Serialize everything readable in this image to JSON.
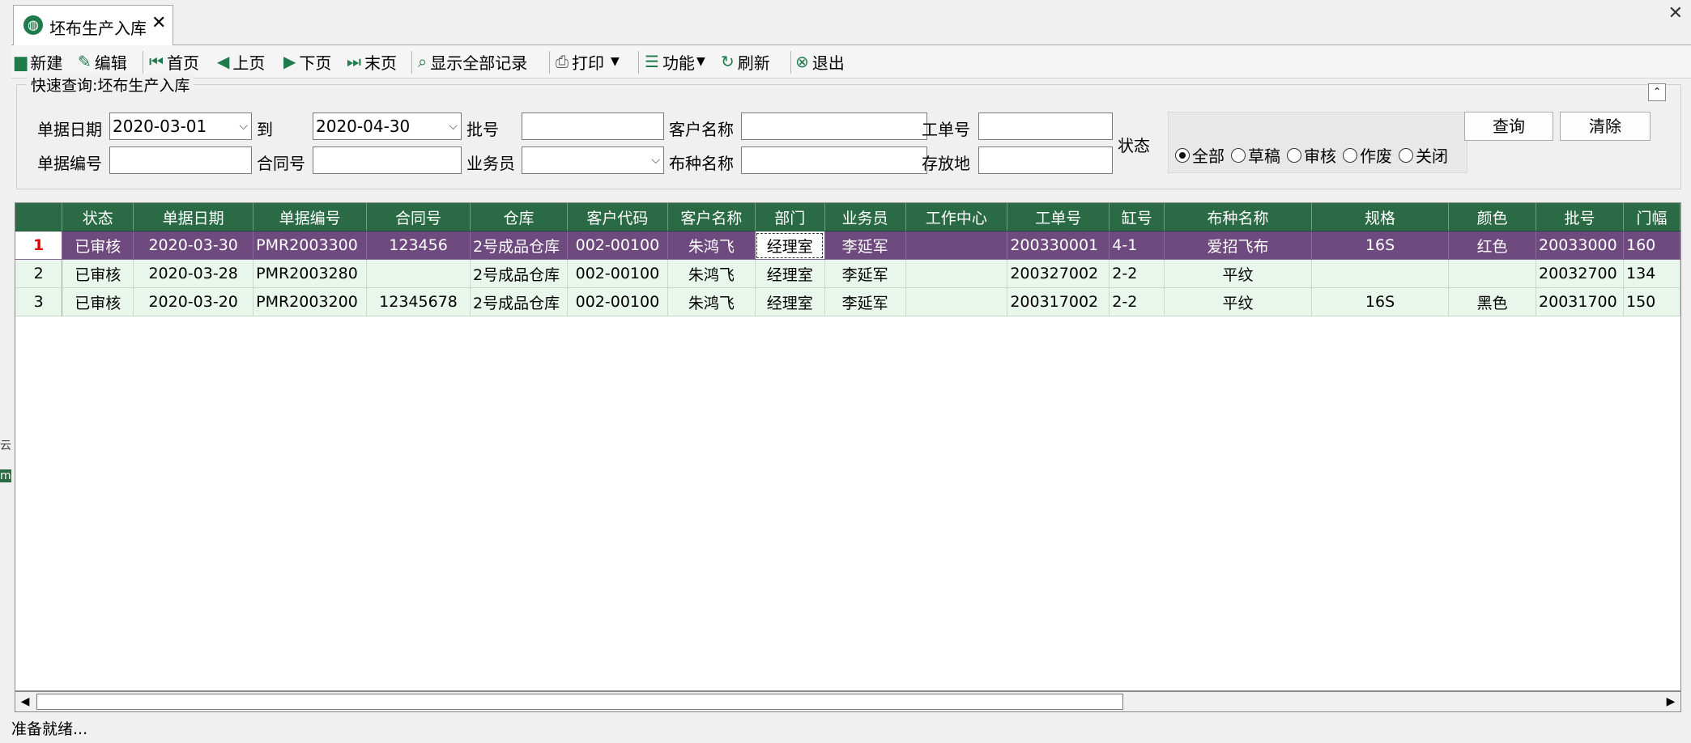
{
  "tab": {
    "title": "坯布生产入库",
    "close": "✕"
  },
  "window": {
    "close": "✕"
  },
  "toolbar": [
    {
      "label": "新建",
      "icon": "new-document-icon"
    },
    {
      "label": "编辑",
      "icon": "edit-icon"
    },
    {
      "label": "首页",
      "icon": "first-page-icon"
    },
    {
      "label": "上页",
      "icon": "previous-page-icon"
    },
    {
      "label": "下页",
      "icon": "next-page-icon"
    },
    {
      "label": "末页",
      "icon": "last-page-icon"
    },
    {
      "label": "显示全部记录",
      "icon": "show-all-icon"
    },
    {
      "label": "打印",
      "icon": "print-icon"
    },
    {
      "label": "功能",
      "icon": "function-list-icon"
    },
    {
      "label": "刷新",
      "icon": "refresh-icon"
    },
    {
      "label": "退出",
      "icon": "exit-icon"
    }
  ],
  "query": {
    "title": "快速查询:坯布生产入库",
    "labels": {
      "date": "单据日期",
      "to": "到",
      "batch": "批号",
      "customer": "客户名称",
      "work_order": "工单号",
      "status": "状态",
      "doc_no": "单据编号",
      "contract": "合同号",
      "salesman": "业务员",
      "fabric": "布种名称",
      "location": "存放地"
    },
    "values": {
      "date_from": "2020-03-01",
      "date_to": "2020-04-30"
    },
    "status_options": [
      "全部",
      "草稿",
      "审核",
      "作废",
      "关闭"
    ],
    "status_selected": "全部",
    "buttons": {
      "search": "查询",
      "clear": "清除"
    }
  },
  "grid": {
    "columns": [
      "状态",
      "单据日期",
      "单据编号",
      "合同号",
      "仓库",
      "客户代码",
      "客户名称",
      "部门",
      "业务员",
      "工作中心",
      "工单号",
      "缸号",
      "布种名称",
      "规格",
      "颜色",
      "批号",
      "门幅"
    ],
    "rows": [
      {
        "n": "1",
        "cells": [
          "已审核",
          "2020-03-30",
          "PMR2003300",
          "123456",
          "2号成品仓库",
          "002-00100",
          "朱鸿飞",
          "经理室",
          "李延军",
          "",
          "200330001",
          "4-1",
          "爱招飞布",
          "16S",
          "红色",
          "20033000",
          "160"
        ]
      },
      {
        "n": "2",
        "cells": [
          "已审核",
          "2020-03-28",
          "PMR2003280",
          "",
          "2号成品仓库",
          "002-00100",
          "朱鸿飞",
          "经理室",
          "李延军",
          "",
          "200327002",
          "2-2",
          "平纹",
          "",
          "",
          "20032700",
          "134"
        ]
      },
      {
        "n": "3",
        "cells": [
          "已审核",
          "2020-03-20",
          "PMR2003200",
          "12345678",
          "2号成品仓库",
          "002-00100",
          "朱鸿飞",
          "经理室",
          "李延军",
          "",
          "200317002",
          "2-2",
          "平纹",
          "16S",
          "黑色",
          "20031700",
          "150"
        ]
      }
    ]
  },
  "statusbar": {
    "text": "准备就绪..."
  },
  "colors": {
    "header_green": "#2a6b45",
    "selected_row": "#6e4a7e",
    "alt_row": "#e9f6ec"
  }
}
